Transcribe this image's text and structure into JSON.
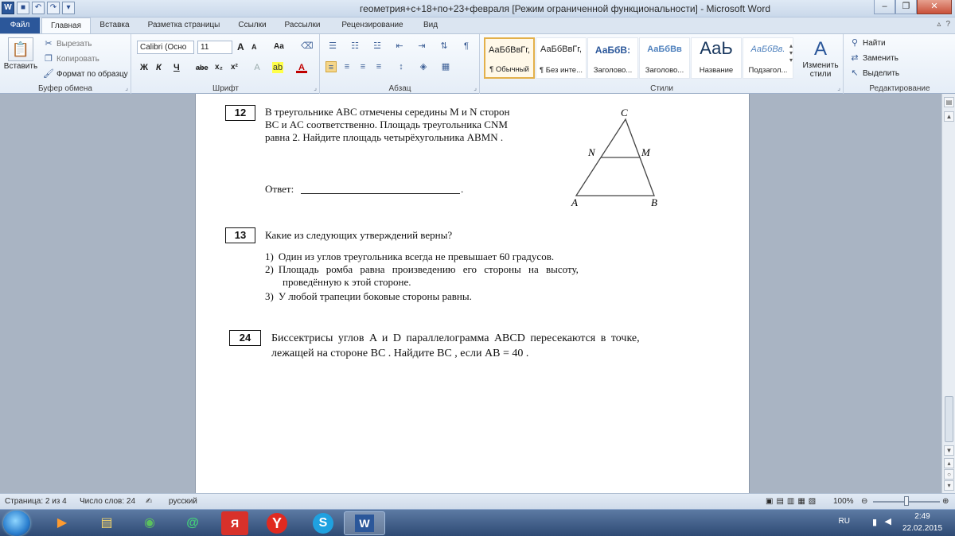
{
  "window": {
    "title": "геометрия+с+18+по+23+февраля [Режим ограниченной функциональности]  -  Microsoft Word"
  },
  "tabs": [
    "Файл",
    "Главная",
    "Вставка",
    "Разметка страницы",
    "Ссылки",
    "Рассылки",
    "Рецензирование",
    "Вид"
  ],
  "ribbon": {
    "clipboard": {
      "paste": "Вставить",
      "cut": "Вырезать",
      "copy": "Копировать",
      "format_painter": "Формат по образцу",
      "label": "Буфер обмена"
    },
    "font": {
      "name": "Calibri (Осно",
      "size": "11",
      "label": "Шрифт",
      "bold": "Ж",
      "italic": "К",
      "underline": "Ч",
      "strike": "abe",
      "sub": "x₂",
      "sup": "x²",
      "grow": "A",
      "shrink": "A",
      "case": "Aa"
    },
    "paragraph": {
      "label": "Абзац"
    },
    "styles": {
      "label": "Стили",
      "items": [
        {
          "preview": "АаБбВвГг,",
          "name": "¶ Обычный"
        },
        {
          "preview": "АаБбВвГг,",
          "name": "¶ Без инте..."
        },
        {
          "preview": "АаБбВ:",
          "name": "Заголово..."
        },
        {
          "preview": "АаБбВв",
          "name": "Заголово..."
        },
        {
          "preview": "АаЬ",
          "name": "Название"
        },
        {
          "preview": "АаБбВв.",
          "name": "Подзагол..."
        }
      ],
      "change_styles": "Изменить стили"
    },
    "editing": {
      "label": "Редактирование",
      "find": "Найти",
      "replace": "Заменить",
      "select": "Выделить"
    }
  },
  "document": {
    "q12": {
      "num": "12",
      "line1": "В треугольнике ABC отмечены середины M и N сторон",
      "line2": "BC и AC соответственно. Площадь треугольника CNM",
      "line3": "равна 2. Найдите площадь четырёхугольника ABMN .",
      "answer": "Ответ:",
      "answer_end": ".",
      "fig": {
        "C": "C",
        "N": "N",
        "M": "M",
        "A": "A",
        "B": "B"
      }
    },
    "q13": {
      "num": "13",
      "question": "Какие из следующих утверждений верны?",
      "items": [
        {
          "n": "1)",
          "text": "Один из углов треугольника всегда не превышает 60 градусов."
        },
        {
          "n": "2)",
          "text": "Площадь ромба равна произведению его стороны на высоту,",
          "text2": "проведённую к этой стороне."
        },
        {
          "n": "3)",
          "text": "У любой трапеции боковые стороны равны."
        }
      ]
    },
    "q24": {
      "num": "24",
      "line1": "Биссектрисы углов A и D параллелограмма ABCD пересекаются в точке,",
      "line2": "лежащей на стороне BC . Найдите BC , если AB = 40 ."
    }
  },
  "status": {
    "page": "Страница: 2 из 4",
    "words": "Число слов: 24",
    "lang": "русский",
    "zoom": "100%"
  },
  "tray": {
    "lang": "RU",
    "time": "2:49",
    "date": "22.02.2015"
  }
}
